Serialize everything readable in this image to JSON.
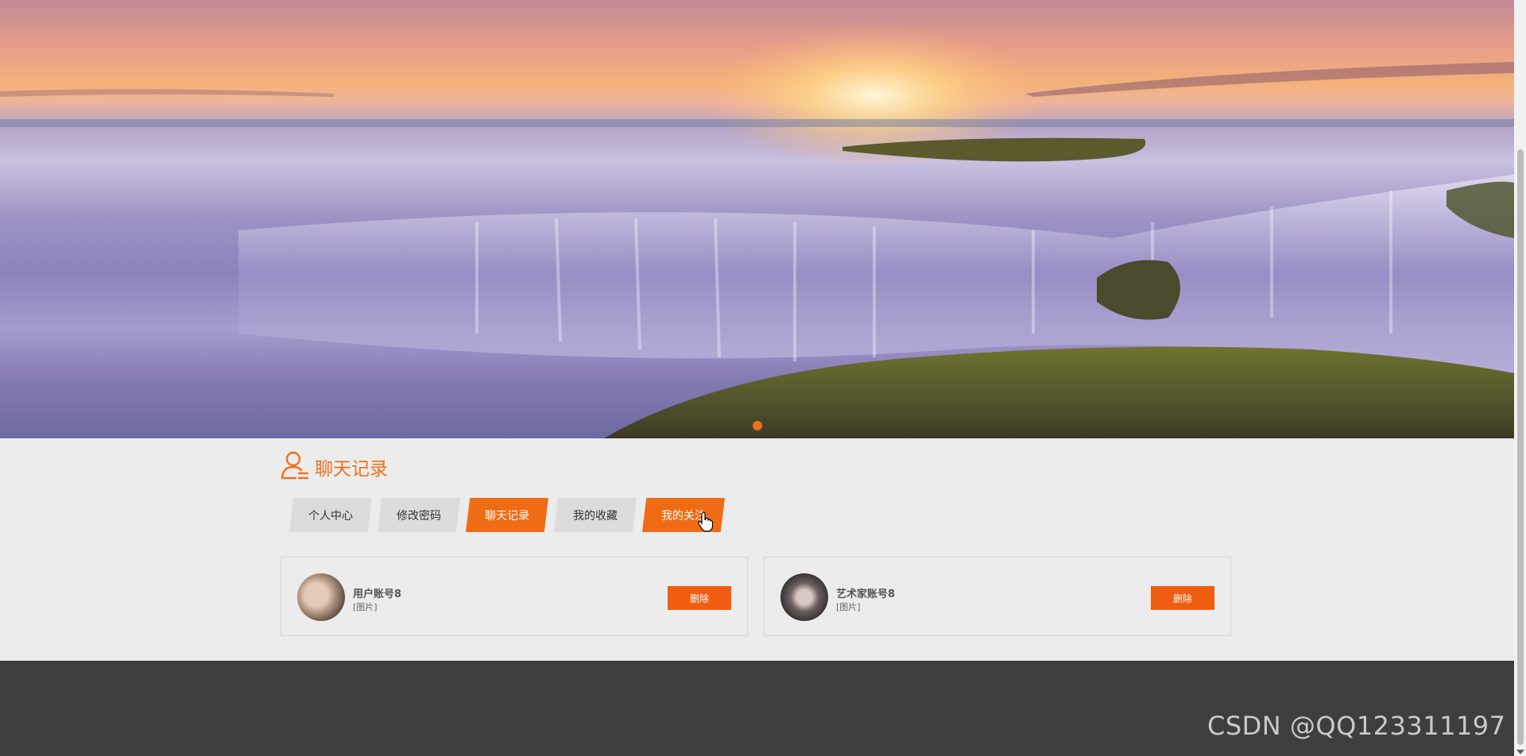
{
  "banner": {
    "image_description": "ocean sunset with water cascading over a mossy rock shelf",
    "active_slide": 1,
    "slide_count": 1
  },
  "section": {
    "title": "聊天记录",
    "icon": "user-list-icon"
  },
  "tabs": [
    {
      "label": "个人中心",
      "active": false
    },
    {
      "label": "修改密码",
      "active": false
    },
    {
      "label": "聊天记录",
      "active": true
    },
    {
      "label": "我的收藏",
      "active": false
    },
    {
      "label": "我的关注",
      "active": true
    }
  ],
  "chats": [
    {
      "name": "用户账号8",
      "preview": "[图片]",
      "delete_label": "删除"
    },
    {
      "name": "艺术家账号8",
      "preview": "[图片]",
      "delete_label": "删除"
    }
  ],
  "watermark": "CSDN @QQ123311197",
  "colors": {
    "accent": "#f06c14",
    "footer": "#3e3e3e",
    "page_bg": "#ececec"
  }
}
